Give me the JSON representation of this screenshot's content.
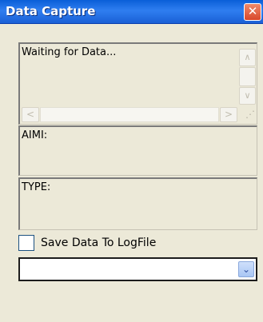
{
  "window": {
    "title": "Data Capture",
    "close_glyph": "✕"
  },
  "data_box": {
    "text": "Waiting for Data...",
    "scroll_up_glyph": "∧",
    "scroll_down_glyph": "∨",
    "scroll_left_glyph": "<",
    "scroll_right_glyph": ">",
    "grip_glyph": "⋰"
  },
  "aimi_box": {
    "label": "AIMI:"
  },
  "type_box": {
    "label": "TYPE:"
  },
  "logfile": {
    "label": "Save Data To LogFile",
    "checked": false
  },
  "combo": {
    "value": "",
    "dropdown_glyph": "⌄"
  },
  "colors": {
    "titlebar": "#2f7ef0",
    "close_button": "#d8472a",
    "window_background": "#ece9d8"
  }
}
